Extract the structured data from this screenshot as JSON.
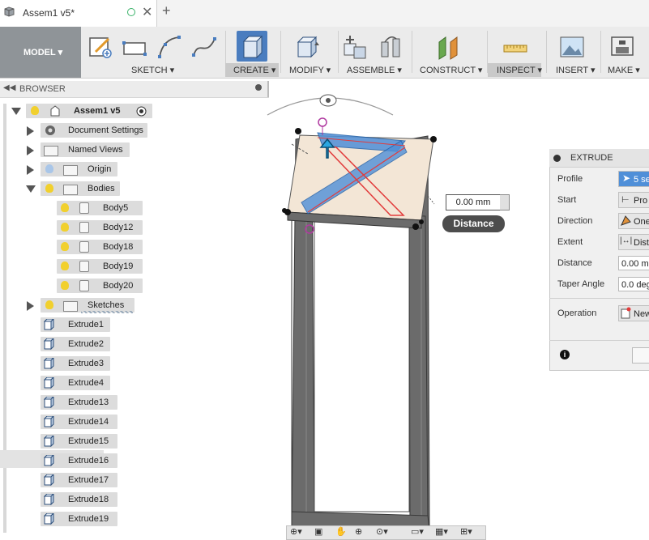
{
  "tab": {
    "title": "Assem1 v5*",
    "close": "✕",
    "add": "+"
  },
  "toolbar": {
    "workspace": "MODEL ▾",
    "groups": [
      {
        "label": "SKETCH ▾"
      },
      {
        "label": "CREATE ▾"
      },
      {
        "label": "MODIFY ▾"
      },
      {
        "label": "ASSEMBLE ▾"
      },
      {
        "label": "CONSTRUCT ▾"
      },
      {
        "label": "INSPECT ▾"
      },
      {
        "label": "INSERT ▾"
      },
      {
        "label": "MAKE ▾"
      }
    ]
  },
  "browser": {
    "title": "BROWSER",
    "root": "Assem1 v5",
    "items": [
      "Document Settings",
      "Named Views",
      "Origin",
      "Bodies",
      "Body5",
      "Body12",
      "Body18",
      "Body19",
      "Body20",
      "Sketches",
      "Extrude1",
      "Extrude2",
      "Extrude3",
      "Extrude4",
      "Extrude13",
      "Extrude14",
      "Extrude15",
      "Extrude16",
      "Extrude17",
      "Extrude18",
      "Extrude19"
    ]
  },
  "viewport": {
    "distance_value": "0.00 mm",
    "distance_label": "Distance"
  },
  "extrude": {
    "title": "EXTRUDE",
    "profile_label": "Profile",
    "profile_value": "5 se",
    "start_label": "Start",
    "start_value": "Pro",
    "direction_label": "Direction",
    "direction_value": "One",
    "extent_label": "Extent",
    "extent_value": "Dist",
    "distance_label": "Distance",
    "distance_value": "0.00 m",
    "taper_label": "Taper Angle",
    "taper_value": "0.0 deg",
    "operation_label": "Operation",
    "operation_value": "New",
    "info_icon": "i"
  },
  "colors": {
    "accent": "#4a7dbf",
    "selection": "#4f8fd8",
    "frame": "#5b5b5b"
  }
}
